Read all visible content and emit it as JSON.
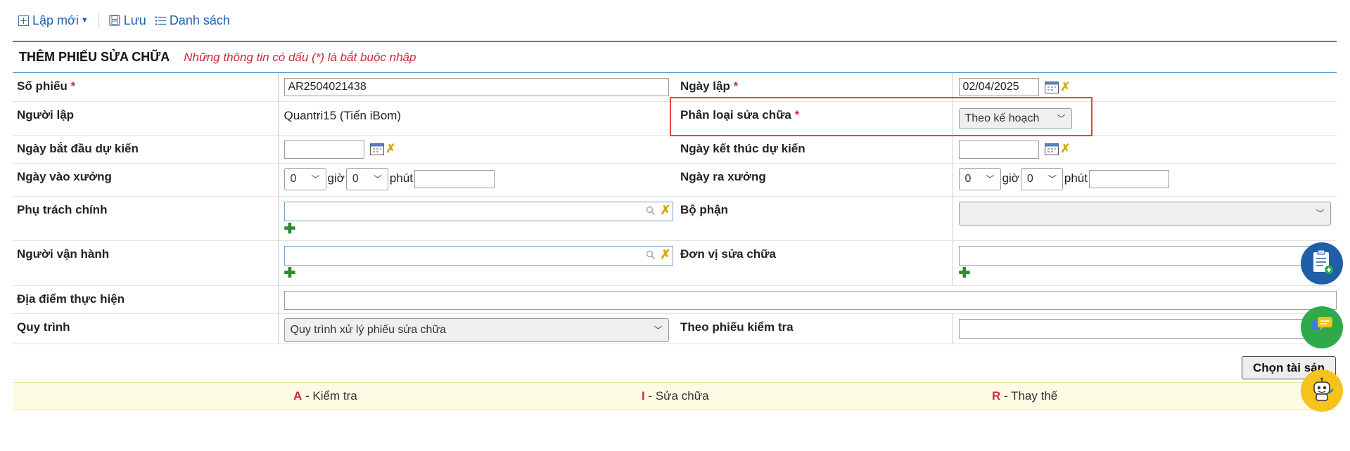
{
  "toolbar": {
    "new_label": "Lập mới",
    "save_label": "Lưu",
    "list_label": "Danh sách"
  },
  "header": {
    "title": "THÊM PHIẾU SỬA CHỮA",
    "note": "Những thông tin có dấu (*) là bắt buộc nhập"
  },
  "form": {
    "so_phieu": {
      "label": "Số phiếu",
      "required": "*",
      "value": "AR2504021438"
    },
    "ngay_lap": {
      "label": "Ngày lập",
      "required": "*",
      "value": "02/04/2025"
    },
    "nguoi_lap": {
      "label": "Người lập",
      "value": "Quantri15 (Tiến iBom)"
    },
    "phan_loai": {
      "label": "Phân loại sửa chữa",
      "required": "*",
      "value": "Theo kế hoạch"
    },
    "ngay_bat_dau": {
      "label": "Ngày bắt đầu dự kiến",
      "value": ""
    },
    "ngay_ket_thuc": {
      "label": "Ngày kết thúc dự kiến",
      "value": ""
    },
    "ngay_vao_xuong": {
      "label": "Ngày vào xưởng",
      "hour": "0",
      "minute": "0",
      "hour_unit": "giờ",
      "minute_unit": "phút",
      "date": ""
    },
    "ngay_ra_xuong": {
      "label": "Ngày ra xưởng",
      "hour": "0",
      "minute": "0",
      "hour_unit": "giờ",
      "minute_unit": "phút",
      "date": ""
    },
    "phu_trach_chinh": {
      "label": "Phụ trách chính",
      "value": ""
    },
    "bo_phan": {
      "label": "Bộ phận",
      "value": ""
    },
    "nguoi_van_hanh": {
      "label": "Người vận hành",
      "value": ""
    },
    "don_vi_sua_chua": {
      "label": "Đơn vị sửa chữa",
      "value": ""
    },
    "dia_diem": {
      "label": "Địa điểm thực hiện",
      "value": ""
    },
    "quy_trinh": {
      "label": "Quy trình",
      "value": "Quy trình xử lý phiếu sửa chữa"
    },
    "theo_phieu_kiem_tra": {
      "label": "Theo phiếu kiểm tra",
      "value": ""
    }
  },
  "actions": {
    "pick_asset": "Chọn tài sản"
  },
  "legend": {
    "a_code": "A",
    "a_text": " - Kiểm tra",
    "i_code": "I",
    "i_text": " - Sửa chữa",
    "r_code": "R",
    "r_text": " - Thay thế"
  },
  "colors": {
    "accent": "#1a5fb4",
    "required": "#d0253a",
    "highlight": "#e04646",
    "legend_bg": "#fefbe4"
  }
}
